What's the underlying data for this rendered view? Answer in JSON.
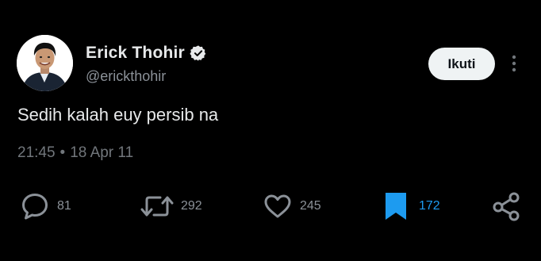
{
  "user": {
    "display_name": "Erick Thohir",
    "handle": "@erickthohir",
    "verified": true,
    "follow_label": "Ikuti"
  },
  "tweet": {
    "text": "Sedih kalah euy persib na",
    "time": "21:45",
    "separator": "•",
    "date": "18 Apr 11"
  },
  "actions": {
    "reply_count": "81",
    "retweet_count": "292",
    "like_count": "245",
    "bookmark_count": "172",
    "bookmarked": true
  },
  "icons": {
    "verified": "verified-badge-icon",
    "more": "more-vertical-icon",
    "reply": "reply-icon",
    "retweet": "retweet-icon",
    "like": "heart-icon",
    "bookmark": "bookmark-icon",
    "share": "share-icon"
  },
  "colors": {
    "background": "#000000",
    "text": "#e7e9ea",
    "muted": "#71767b",
    "accent": "#1d9bf0",
    "follow_button": "#eff3f4"
  }
}
